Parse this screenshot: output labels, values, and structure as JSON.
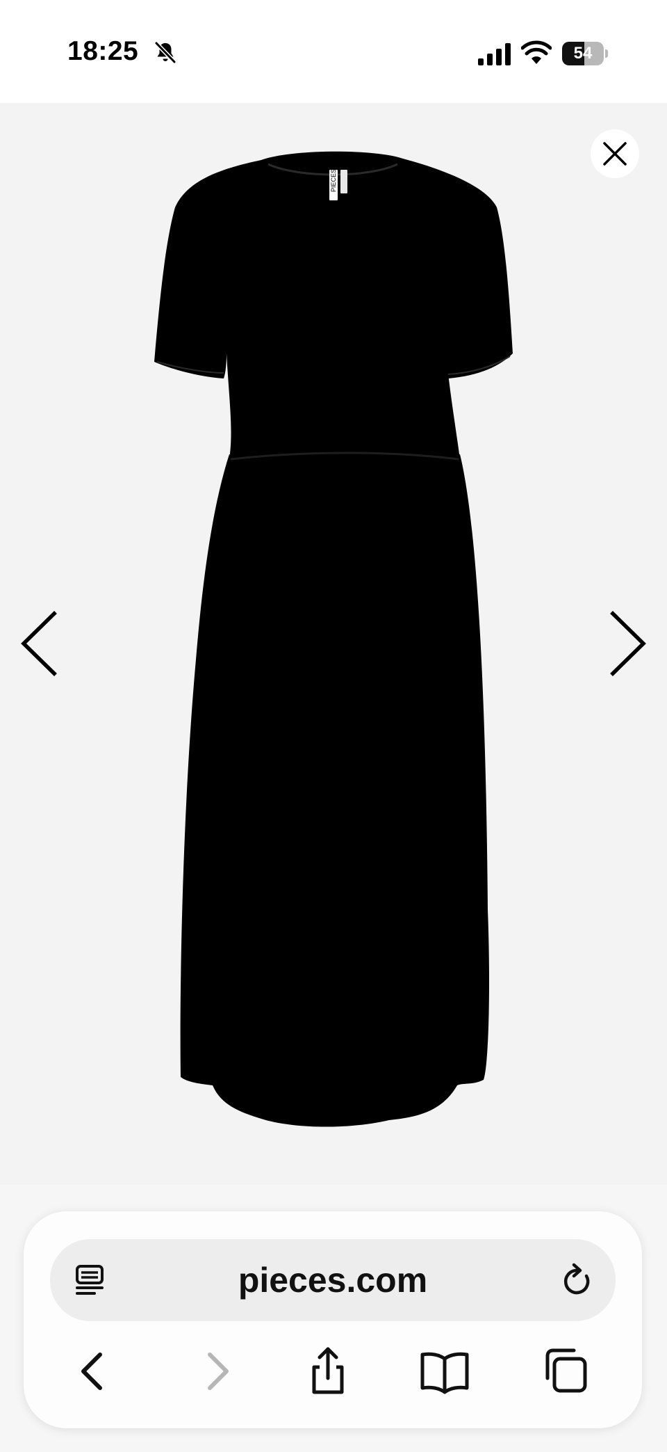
{
  "status_bar": {
    "time": "18:25",
    "battery_level": "54",
    "battery_fraction": 0.54,
    "icons": [
      "bell-slash-icon",
      "cellular-signal-icon",
      "wifi-icon",
      "battery-icon"
    ]
  },
  "viewer": {
    "background": "#f3f3f3",
    "product_image": "black-short-sleeve-maxi-dress",
    "garment_label_text": "PIECES",
    "controls": [
      "close-icon",
      "chevron-left-icon",
      "chevron-right-icon"
    ]
  },
  "browser": {
    "url": "pieces.com",
    "toolbar": [
      "back-icon",
      "forward-icon",
      "share-icon",
      "bookmarks-icon",
      "tabs-icon"
    ],
    "forward_disabled": true
  }
}
